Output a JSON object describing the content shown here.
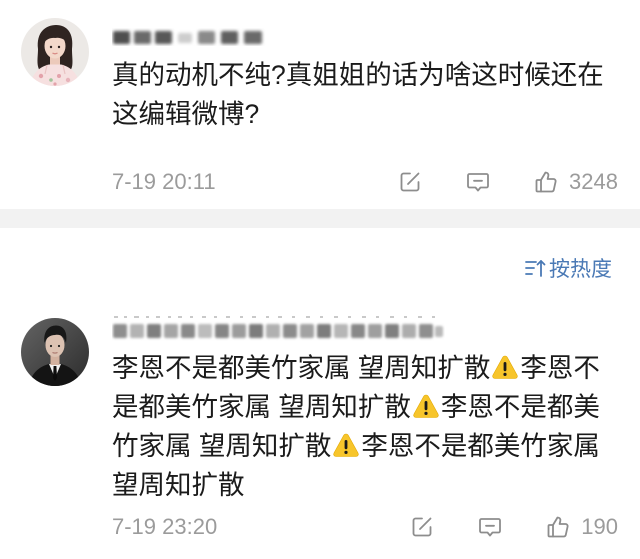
{
  "comments": [
    {
      "lines": [
        [
          {
            "text": "真的动机不纯?真姐姐的话为啥这时候还在"
          }
        ],
        [
          {
            "text": "这编辑微博?"
          }
        ]
      ],
      "time": "7-19 20:11",
      "like_count": "3248"
    },
    {
      "lines": [
        [
          {
            "text": "李恩不是都美竹家属 望周知扩散"
          },
          {
            "emoji": "warning-sign"
          },
          {
            "text": "李恩不"
          }
        ],
        [
          {
            "text": "是都美竹家属 望周知扩散"
          },
          {
            "emoji": "warning-sign"
          },
          {
            "text": "李恩不是都美"
          }
        ],
        [
          {
            "text": "竹家属 望周知扩散"
          },
          {
            "emoji": "warning-sign"
          },
          {
            "text": "李恩不是都美竹家属"
          }
        ],
        [
          {
            "text": "望周知扩散"
          }
        ]
      ],
      "time": "7-19 23:20",
      "like_count": "190"
    }
  ],
  "sort": {
    "icon": "sort-icon",
    "label": "按热度"
  },
  "action_icons": [
    "share-icon",
    "comment-icon",
    "like-icon"
  ],
  "colors": {
    "accent": "#4a79b5",
    "divider": "#f2f2f2",
    "meta_text": "#9b9b9b",
    "body_text": "#1b1b1b",
    "warning_emoji": "#f7c52b"
  }
}
